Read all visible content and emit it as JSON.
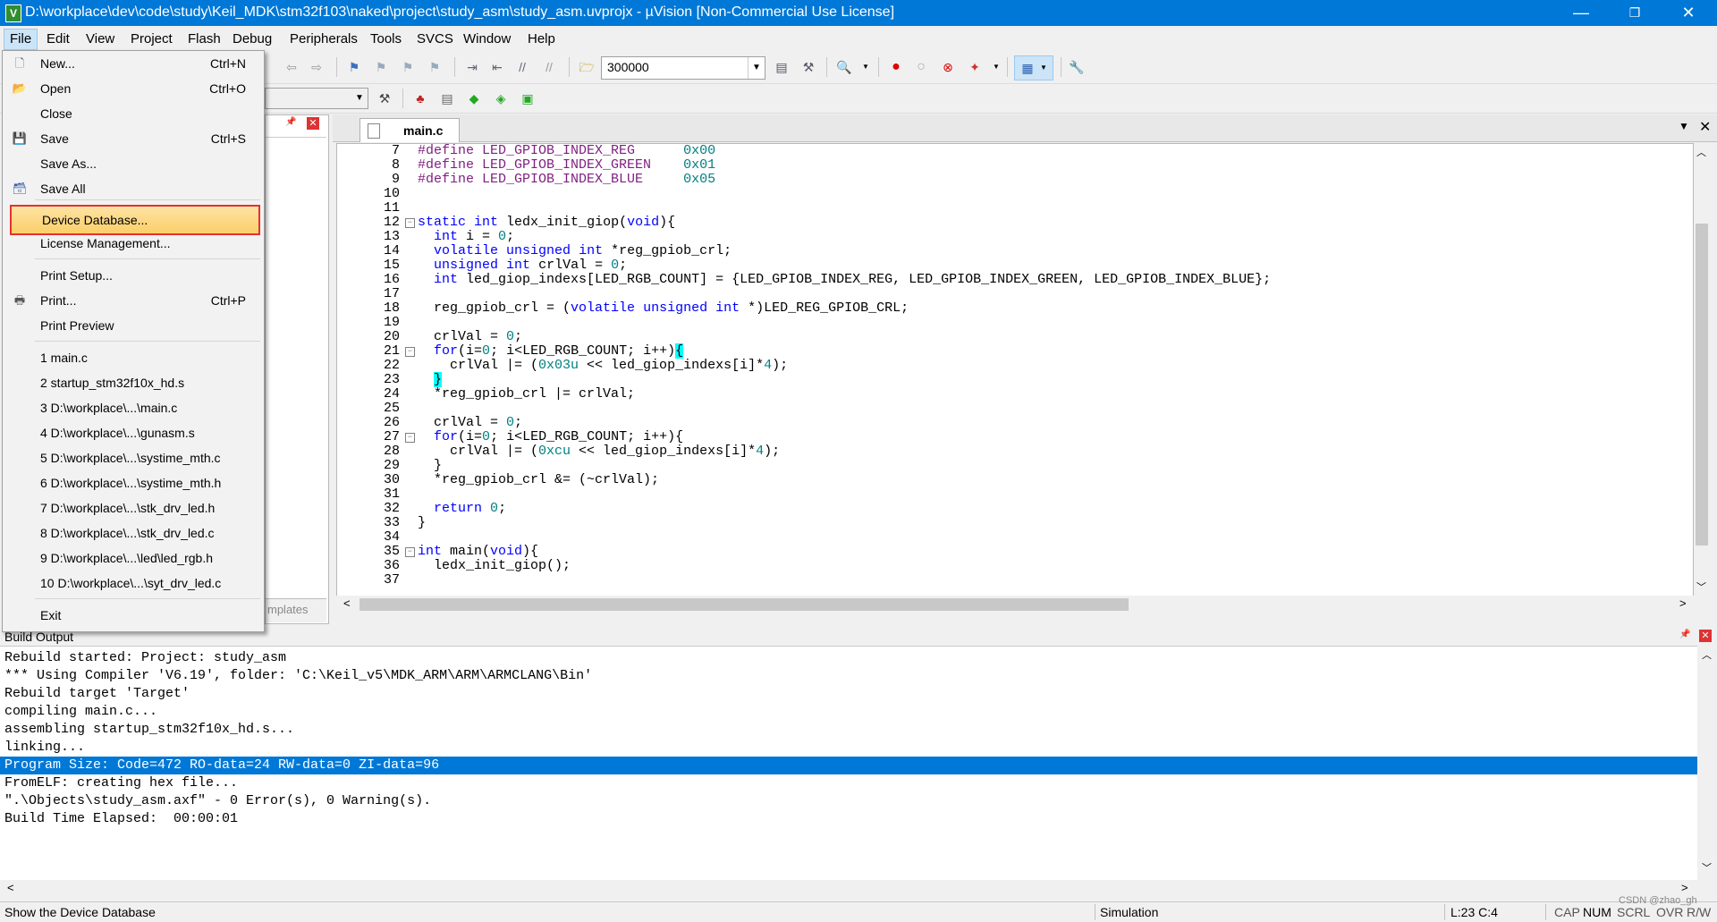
{
  "window": {
    "title": "D:\\workplace\\dev\\code\\study\\Keil_MDK\\stm32f103\\naked\\project\\study_asm\\study_asm.uvprojx - µVision  [Non-Commercial Use License]",
    "minimize": "—",
    "restore": "❐",
    "close": "✕"
  },
  "menubar": [
    "File",
    "Edit",
    "View",
    "Project",
    "Flash",
    "Debug",
    "Peripherals",
    "Tools",
    "SVCS",
    "Window",
    "Help"
  ],
  "toolbar": {
    "find_value": "300000"
  },
  "file_menu": {
    "items": [
      {
        "label": "New...",
        "shortcut": "Ctrl+N",
        "icon": "new-file-icon"
      },
      {
        "label": "Open",
        "shortcut": "Ctrl+O",
        "icon": "open-folder-icon"
      },
      {
        "label": "Close",
        "shortcut": "",
        "icon": ""
      },
      {
        "label": "Save",
        "shortcut": "Ctrl+S",
        "icon": "save-icon"
      },
      {
        "label": "Save As...",
        "shortcut": "",
        "icon": ""
      },
      {
        "label": "Save All",
        "shortcut": "",
        "icon": "save-all-icon"
      },
      {
        "label": "Device Database...",
        "shortcut": "",
        "icon": ""
      },
      {
        "label": "License Management...",
        "shortcut": "",
        "icon": ""
      },
      {
        "label": "Print Setup...",
        "shortcut": "",
        "icon": ""
      },
      {
        "label": "Print...",
        "shortcut": "Ctrl+P",
        "icon": "print-icon"
      },
      {
        "label": "Print Preview",
        "shortcut": "",
        "icon": ""
      },
      {
        "label": "1 main.c",
        "shortcut": "",
        "icon": ""
      },
      {
        "label": "2 startup_stm32f10x_hd.s",
        "shortcut": "",
        "icon": ""
      },
      {
        "label": "3 D:\\workplace\\...\\main.c",
        "shortcut": "",
        "icon": ""
      },
      {
        "label": "4 D:\\workplace\\...\\gunasm.s",
        "shortcut": "",
        "icon": ""
      },
      {
        "label": "5 D:\\workplace\\...\\systime_mth.c",
        "shortcut": "",
        "icon": ""
      },
      {
        "label": "6 D:\\workplace\\...\\systime_mth.h",
        "shortcut": "",
        "icon": ""
      },
      {
        "label": "7 D:\\workplace\\...\\stk_drv_led.h",
        "shortcut": "",
        "icon": ""
      },
      {
        "label": "8 D:\\workplace\\...\\stk_drv_led.c",
        "shortcut": "",
        "icon": ""
      },
      {
        "label": "9 D:\\workplace\\...\\led\\led_rgb.h",
        "shortcut": "",
        "icon": ""
      },
      {
        "label": "10 D:\\workplace\\...\\syt_drv_led.c",
        "shortcut": "",
        "icon": ""
      },
      {
        "label": "Exit",
        "shortcut": "",
        "icon": ""
      }
    ]
  },
  "project_panel": {
    "tab_label": "mplates"
  },
  "editor": {
    "tab_label": "main.c",
    "lines": [
      {
        "n": "7",
        "text": "#define LED_GPIOB_INDEX_REG      0x00"
      },
      {
        "n": "8",
        "text": "#define LED_GPIOB_INDEX_GREEN    0x01"
      },
      {
        "n": "9",
        "text": "#define LED_GPIOB_INDEX_BLUE     0x05"
      },
      {
        "n": "10",
        "text": ""
      },
      {
        "n": "11",
        "text": ""
      },
      {
        "n": "12",
        "text": "static int ledx_init_giop(void){"
      },
      {
        "n": "13",
        "text": "  int i = 0;"
      },
      {
        "n": "14",
        "text": "  volatile unsigned int *reg_gpiob_crl;"
      },
      {
        "n": "15",
        "text": "  unsigned int crlVal = 0;"
      },
      {
        "n": "16",
        "text": "  int led_giop_indexs[LED_RGB_COUNT] = {LED_GPIOB_INDEX_REG, LED_GPIOB_INDEX_GREEN, LED_GPIOB_INDEX_BLUE};"
      },
      {
        "n": "17",
        "text": ""
      },
      {
        "n": "18",
        "text": "  reg_gpiob_crl = (volatile unsigned int *)LED_REG_GPIOB_CRL;"
      },
      {
        "n": "19",
        "text": ""
      },
      {
        "n": "20",
        "text": "  crlVal = 0;"
      },
      {
        "n": "21",
        "text": "  for(i=0; i<LED_RGB_COUNT; i++){"
      },
      {
        "n": "22",
        "text": "    crlVal |= (0x03u << led_giop_indexs[i]*4);"
      },
      {
        "n": "23",
        "text": "  }"
      },
      {
        "n": "24",
        "text": "  *reg_gpiob_crl |= crlVal;"
      },
      {
        "n": "25",
        "text": ""
      },
      {
        "n": "26",
        "text": "  crlVal = 0;"
      },
      {
        "n": "27",
        "text": "  for(i=0; i<LED_RGB_COUNT; i++){"
      },
      {
        "n": "28",
        "text": "    crlVal |= (0xcu << led_giop_indexs[i]*4);"
      },
      {
        "n": "29",
        "text": "  }"
      },
      {
        "n": "30",
        "text": "  *reg_gpiob_crl &= (~crlVal);"
      },
      {
        "n": "31",
        "text": ""
      },
      {
        "n": "32",
        "text": "  return 0;"
      },
      {
        "n": "33",
        "text": "}"
      },
      {
        "n": "34",
        "text": ""
      },
      {
        "n": "35",
        "text": "int main(void){"
      },
      {
        "n": "36",
        "text": "  ledx_init_giop();"
      },
      {
        "n": "37",
        "text": ""
      }
    ]
  },
  "build_output": {
    "title": "Build Output",
    "lines": [
      "Rebuild started: Project: study_asm",
      "*** Using Compiler 'V6.19', folder: 'C:\\Keil_v5\\MDK_ARM\\ARM\\ARMCLANG\\Bin'",
      "Rebuild target 'Target'",
      "compiling main.c...",
      "assembling startup_stm32f10x_hd.s...",
      "linking...",
      "Program Size: Code=472 RO-data=24 RW-data=0 ZI-data=96",
      "FromELF: creating hex file...",
      "\".\\Objects\\study_asm.axf\" - 0 Error(s), 0 Warning(s).",
      "Build Time Elapsed:  00:00:01"
    ]
  },
  "statusbar": {
    "message": "Show the Device Database",
    "mode": "Simulation",
    "position": "L:23 C:4",
    "cap": "CAP",
    "num": "NUM",
    "scrl": "SCRL",
    "ovr": "OVR",
    "rw": "R/W"
  },
  "watermark": "CSDN @zhao_gh"
}
